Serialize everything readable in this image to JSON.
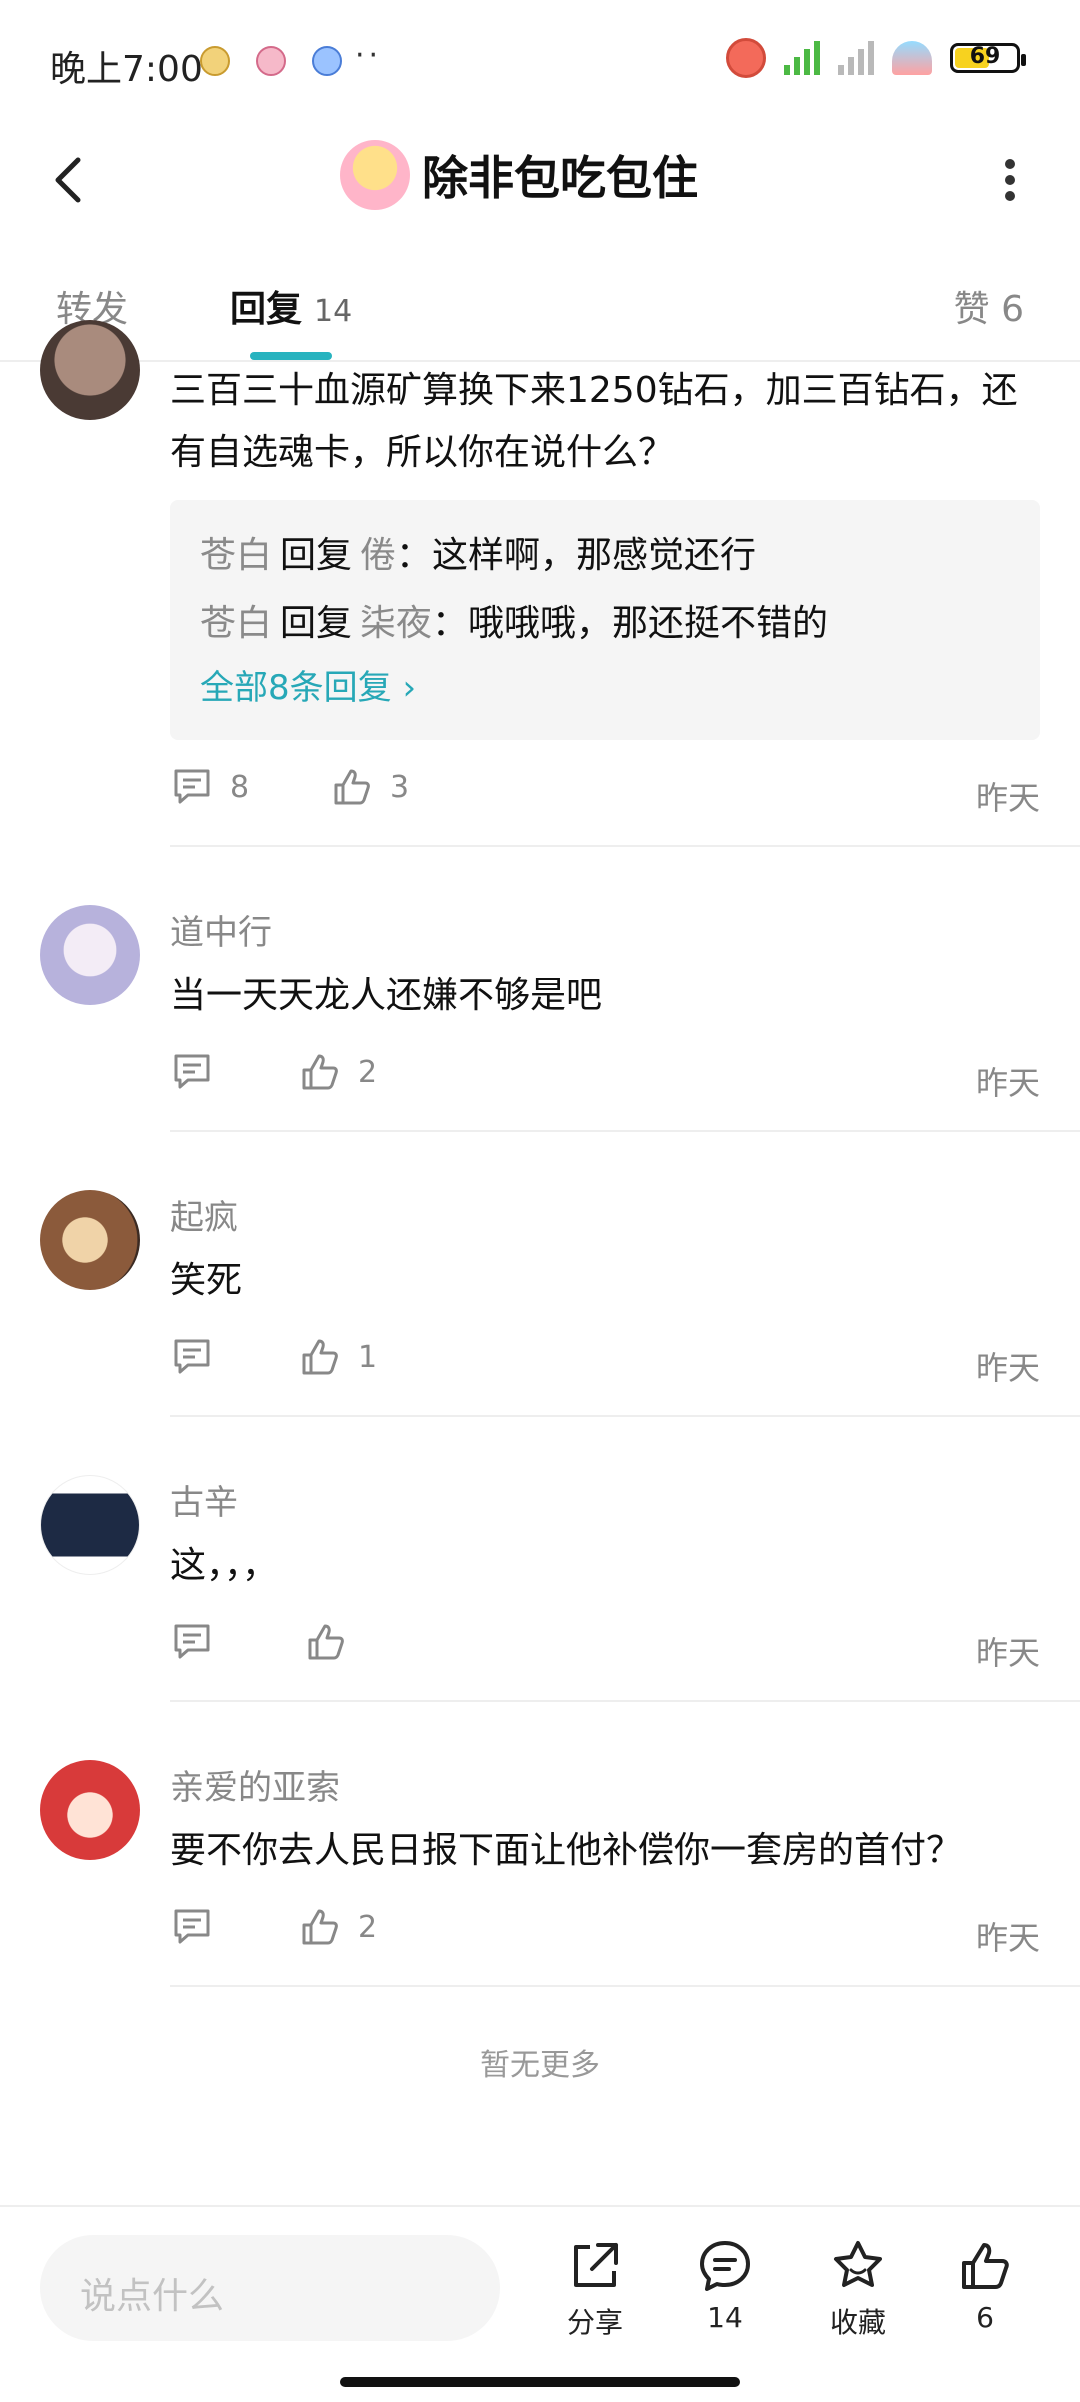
{
  "status_bar": {
    "time": "晚上7:00",
    "battery": "69",
    "dots": "··"
  },
  "header": {
    "title": "除非包吃包住"
  },
  "tabs": {
    "forward": "转发",
    "reply": "回复",
    "reply_count": "14",
    "like": "赞 6"
  },
  "comments": [
    {
      "text": "三百三十血源矿算换下来1250钻石，加三百钻石，还有自选魂卡，所以你在说什么？",
      "sub_replies": [
        {
          "from": "苍白",
          "reply_word": "回复",
          "to": "倦",
          "text": "：这样啊，那感觉还行"
        },
        {
          "from": "苍白",
          "reply_word": "回复",
          "to": "柒夜",
          "text": "：哦哦哦，那还挺不错的"
        }
      ],
      "sub_more": "全部8条回复 ›",
      "reply_count": "8",
      "like_count": "3",
      "time": "昨天"
    },
    {
      "name": "道中行",
      "text": "当一天天龙人还嫌不够是吧",
      "reply_count": "",
      "like_count": "2",
      "time": "昨天"
    },
    {
      "name": "起疯",
      "text": "笑死",
      "reply_count": "",
      "like_count": "1",
      "time": "昨天"
    },
    {
      "name": "古辛",
      "text": "这，，，",
      "reply_count": "",
      "like_count": "",
      "time": "昨天"
    },
    {
      "name": "亲爱的亚索",
      "text": "要不你去人民日报下面让他补偿你一套房的首付？",
      "reply_count": "",
      "like_count": "2",
      "time": "昨天"
    }
  ],
  "no_more": "暂无更多",
  "bottom_bar": {
    "input_placeholder": "说点什么",
    "share": "分享",
    "comments": "14",
    "favorite": "收藏",
    "likes": "6"
  }
}
